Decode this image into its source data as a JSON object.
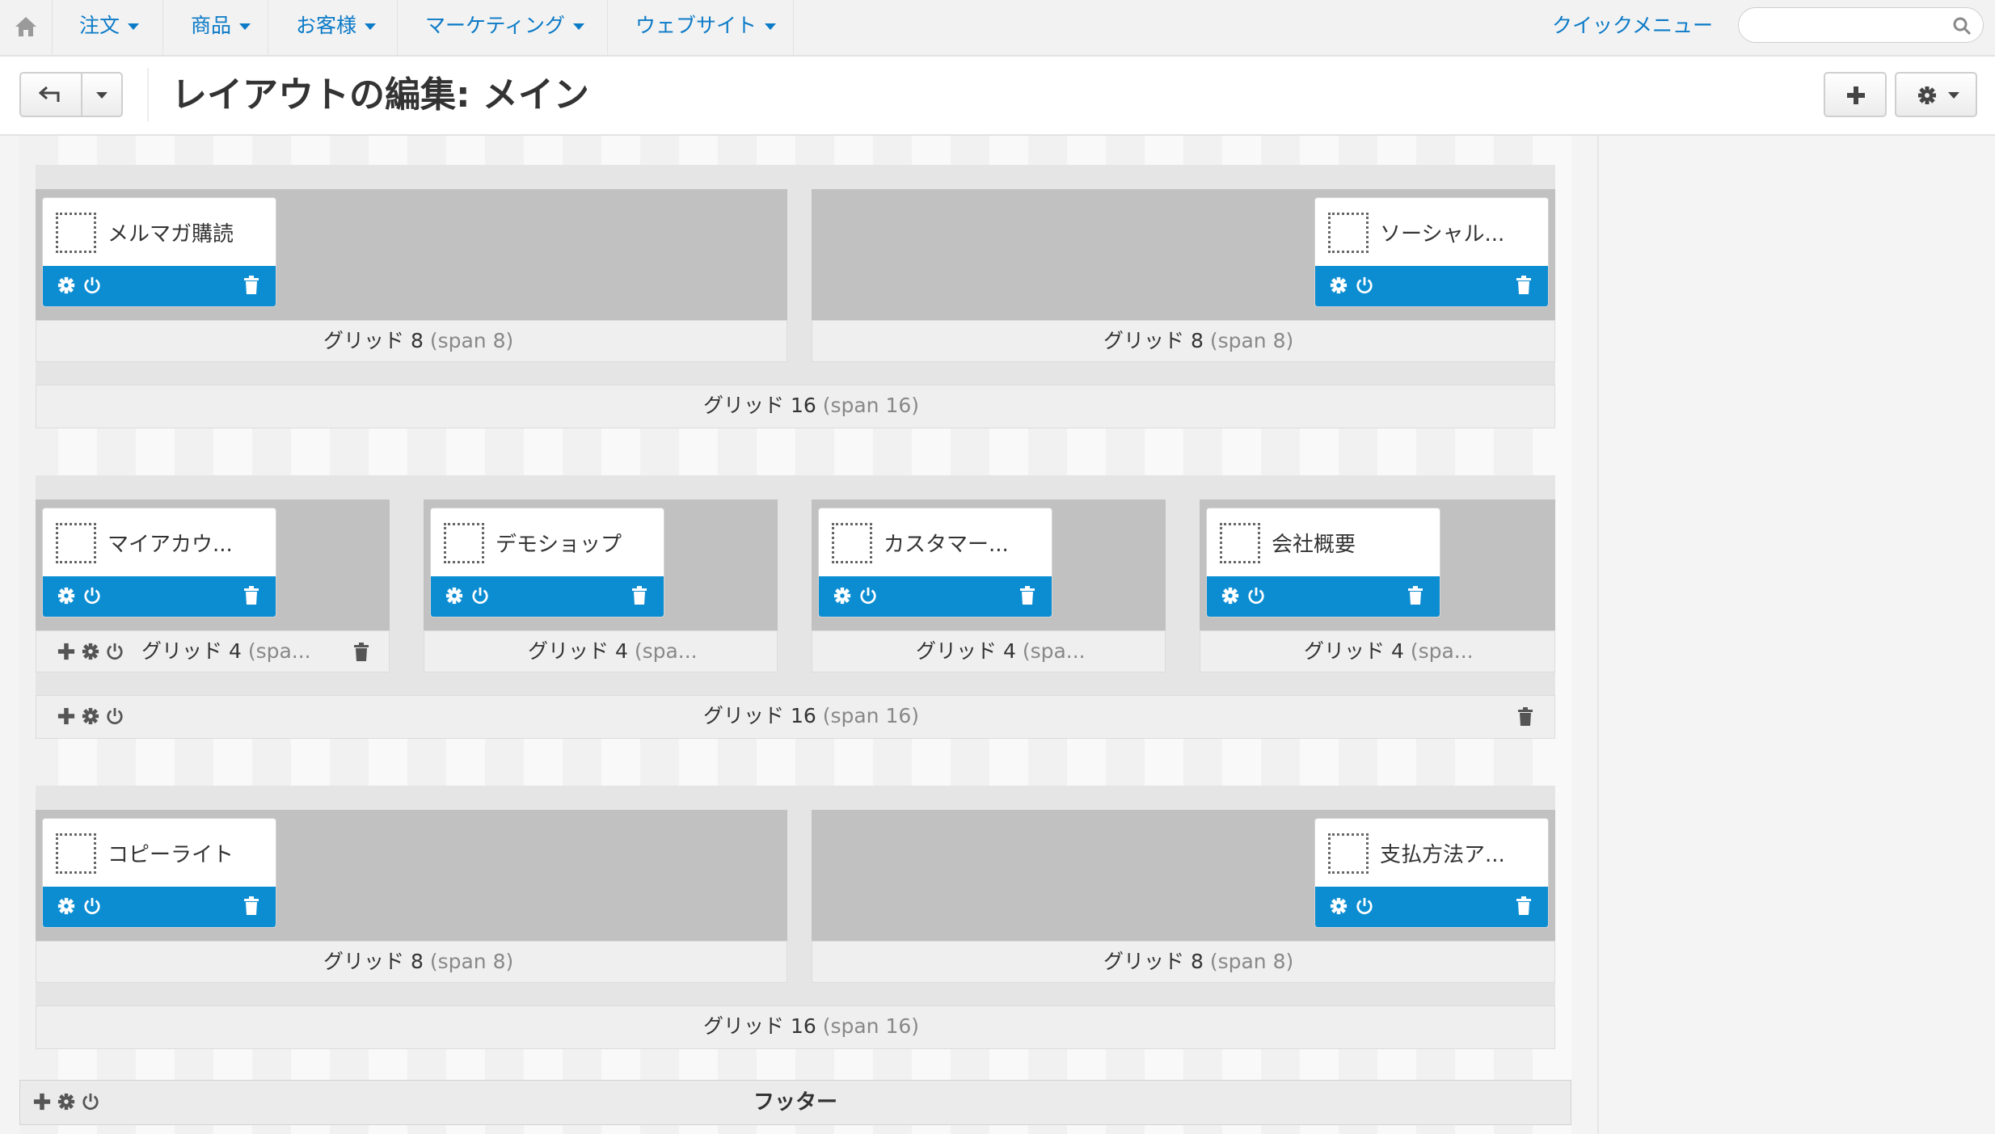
{
  "topnav": {
    "menus": [
      {
        "label": "注文"
      },
      {
        "label": "商品"
      },
      {
        "label": "お客様"
      },
      {
        "label": "マーケティング"
      },
      {
        "label": "ウェブサイト"
      }
    ],
    "quick_menu": "クイックメニュー",
    "search": {
      "value": "",
      "placeholder": ""
    }
  },
  "header": {
    "title": "レイアウトの編集: メイン"
  },
  "containers": [
    {
      "label": "グリッド 16",
      "span": "(span 16)",
      "cells": [
        {
          "label": "グリッド 8",
          "span": "(span 8)",
          "block": "メルマガ購読"
        },
        {
          "label": "グリッド 8",
          "span": "(span 8)",
          "block": "ソーシャル..."
        }
      ]
    },
    {
      "label": "グリッド 16",
      "span": "(span 16)",
      "cells": [
        {
          "label": "グリッド 4",
          "span": "(spa...",
          "block": "マイアカウ..."
        },
        {
          "label": "グリッド 4",
          "span": "(spa...",
          "block": "デモショップ"
        },
        {
          "label": "グリッド 4",
          "span": "(spa...",
          "block": "カスタマー..."
        },
        {
          "label": "グリッド 4",
          "span": "(spa...",
          "block": "会社概要"
        }
      ]
    },
    {
      "label": "グリッド 16",
      "span": "(span 16)",
      "cells": [
        {
          "label": "グリッド 8",
          "span": "(span 8)",
          "block": "コピーライト"
        },
        {
          "label": "グリッド 8",
          "span": "(span 8)",
          "block": "支払方法ア..."
        }
      ]
    }
  ],
  "footer": {
    "label": "フッター"
  },
  "icons": {
    "home": "home-icon",
    "search": "search-icon",
    "back": "back-arrow-icon",
    "add": "plus-icon",
    "settings": "gear-icon",
    "power": "power-icon",
    "delete": "trash-icon",
    "block": "dotted-square-icon"
  },
  "colors": {
    "link": "#0b7ac7",
    "block_bar": "#0c8dd2",
    "cell_bg": "#c1c1c1"
  }
}
